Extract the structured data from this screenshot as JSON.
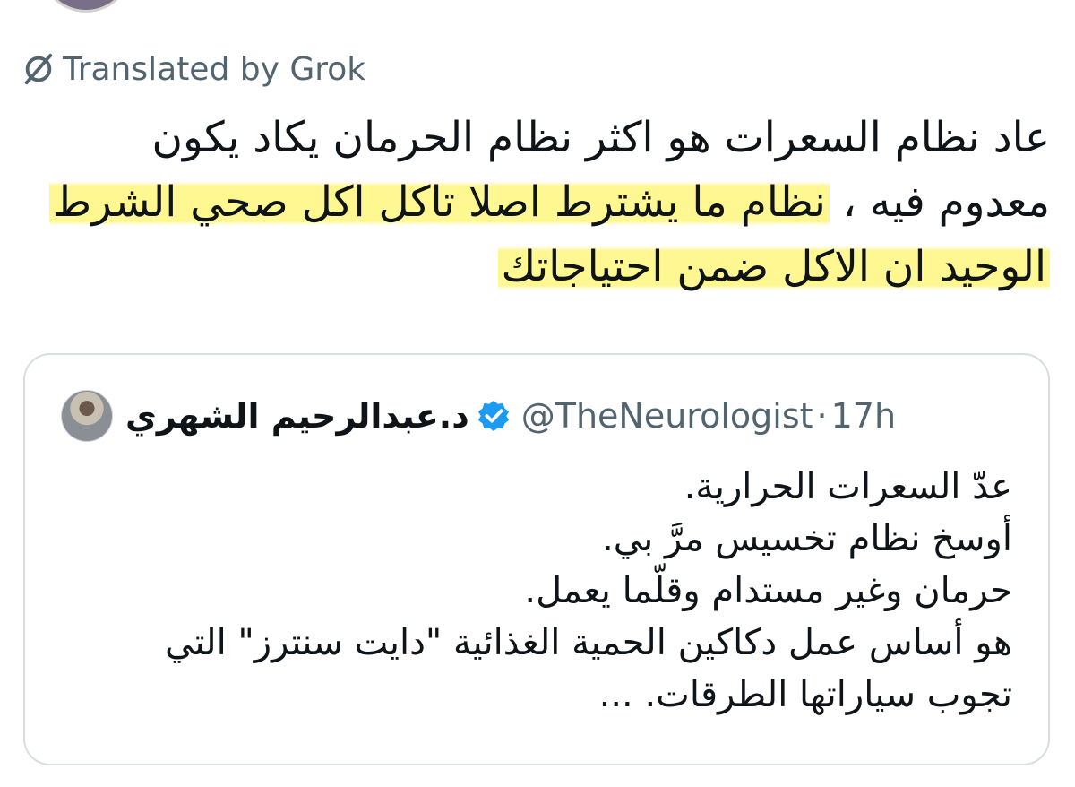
{
  "translation": {
    "label": "Translated by Grok",
    "icon": "grok-icon"
  },
  "post": {
    "lines": [
      {
        "before": "عاد نظام السعرات هو اكثر نظام الحرمان يكاد يكون",
        "highlight": ""
      },
      {
        "before": "معدوم فيه ، ",
        "highlight": "نظام ما يشترط اصلا تاكل اكل صحي الشرط"
      },
      {
        "before": "",
        "highlight": "الوحيد ان الاكل ضمن احتياجاتك"
      }
    ],
    "highlight_color": "#fff46e"
  },
  "quote": {
    "author_name": "د.عبدالرحيم الشهري",
    "verified_icon": "verified-badge-icon",
    "handle": "@TheNeurologist",
    "separator": "·",
    "time": "17h",
    "lines": [
      "عدّ السعرات الحرارية.",
      "أوسخ نظام تخسيس مرَّ بي.",
      "حرمان وغير مستدام وقلّما يعمل.",
      "هو أساس عمل دكاكين الحمية الغذائية \"دايت سنترز\" التي",
      "تجوب سياراتها الطرقات. ..."
    ]
  },
  "colors": {
    "text": "#0f1419",
    "secondary": "#536471",
    "verified": "#1d9bf0",
    "border": "#d9dee2"
  }
}
